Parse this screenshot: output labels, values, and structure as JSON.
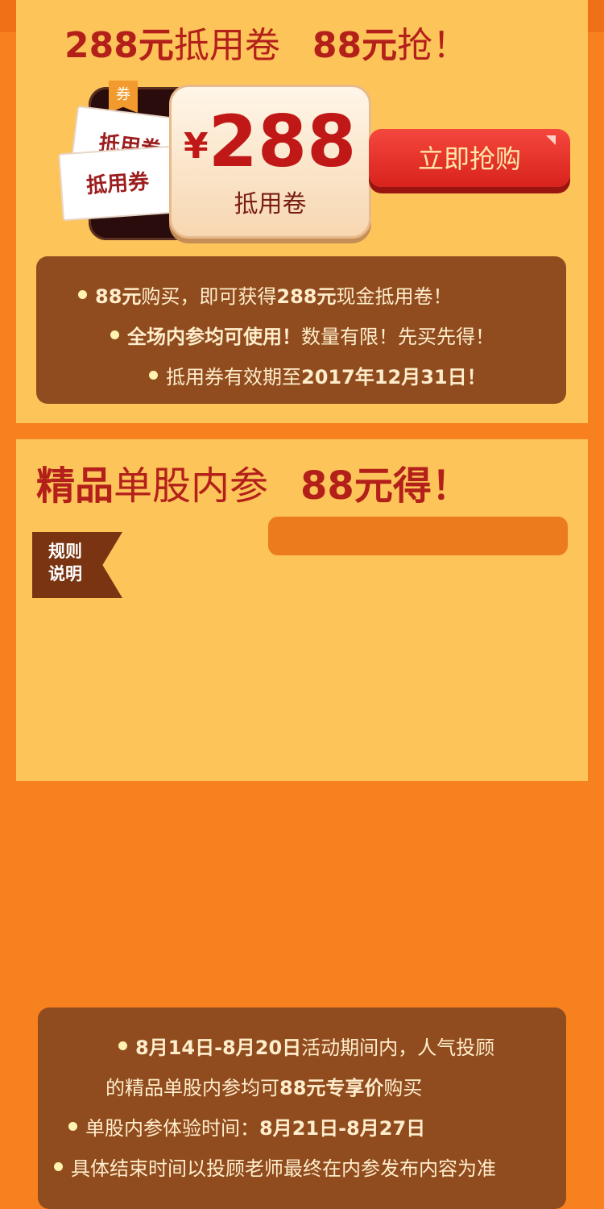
{
  "section1": {
    "title": {
      "part1_bold": "288元",
      "part1_light": "抵用卷",
      "part2_bold": "88元",
      "part2_light": "抢！"
    },
    "coupon": {
      "badge": "券",
      "ticket_text": "抵用券",
      "currency": "¥",
      "amount": "288",
      "label": "抵用卷"
    },
    "buy_button": "立即抢购",
    "bullets": [
      {
        "b1": "88元",
        "t1": "购买，即可获得",
        "b2": "288元",
        "t2": "现金抵用卷！"
      },
      {
        "b1": "全场内参均可使用！",
        "t1": "数量有限！先买先得！"
      },
      {
        "t1": "抵用券有效期至",
        "b1": "2017年12月31日！"
      }
    ]
  },
  "section2": {
    "title": {
      "part1_bold": "精品",
      "part1_light": "单股内参",
      "part2_bold": "88元得！"
    },
    "rule_tag": "规则说明",
    "bullets": [
      {
        "b1": "8月14日-8月20日",
        "t1": "活动期间内，人气投顾"
      },
      {
        "t1": "的精品单股内参均可",
        "b1": "88元专享价",
        "t2": "购买"
      },
      {
        "t1": "单股内参体验时间：",
        "b1": "8月21日-8月27日"
      },
      {
        "t1": "具体结束时间以投顾老师最终在内参发布内容为准"
      }
    ]
  },
  "colors": {
    "background": "#f7811e",
    "panel": "#fdc45a",
    "title_red": "#b3201a",
    "info_brown": "#904c1e",
    "button_red": "#e0302a"
  }
}
